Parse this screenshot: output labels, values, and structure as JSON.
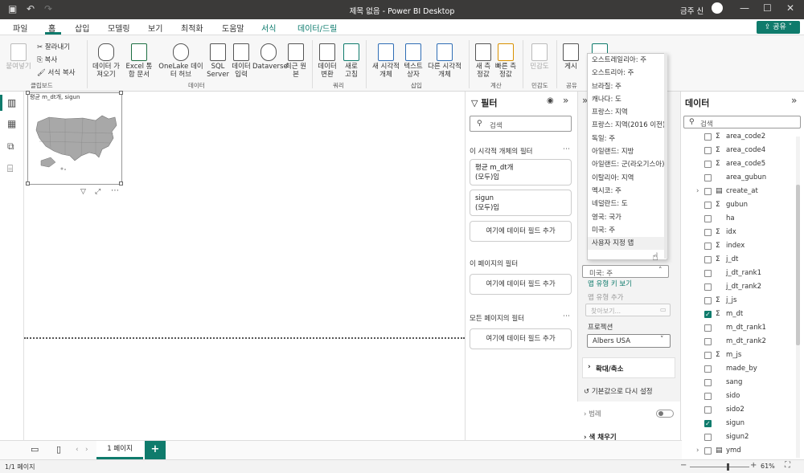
{
  "title": "제목 없음 - Power BI Desktop",
  "user": "금주 신",
  "share_label": "공유",
  "menu": [
    "파일",
    "홈",
    "삽입",
    "모델링",
    "보기",
    "최적화",
    "도움말",
    "서식",
    "데이터/드릴"
  ],
  "ribbon": {
    "clipboard": {
      "paste": "붙여넣기",
      "cut": "잘라내기",
      "copy": "복사",
      "format_painter": "서식 복사",
      "group": "클립보드"
    },
    "data_buttons": [
      "데이터 가져오기",
      "Excel 통합 문서",
      "OneLake 데이터 허브",
      "SQL Server",
      "데이터 입력",
      "Dataverse",
      "최근 원본"
    ],
    "data_group": "데이터",
    "query_buttons": [
      "데이터 변환",
      "새로 고침"
    ],
    "query_group": "쿼리",
    "insert_buttons": [
      "새 시각적 개체",
      "텍스트 상자",
      "다른 시각적 개체"
    ],
    "insert_group": "삽입",
    "calc_buttons": [
      "새 측정값",
      "빠른 측정값"
    ],
    "calc_group": "계산",
    "sensitivity": "민감도",
    "sensitivity_group": "민감도",
    "publish": "게시",
    "share_group": "공유"
  },
  "visual": {
    "title": "평균 m_dt개, sigun"
  },
  "filters": {
    "header": "필터",
    "search_placeholder": "검색",
    "visual_section": "이 시각적 개체의 필터",
    "cards": [
      {
        "name": "평균 m_dt개",
        "state": "(모두)임"
      },
      {
        "name": "sigun",
        "state": "(모두)임"
      }
    ],
    "add_field": "여기에 데이터 필드 추가",
    "page_section": "이 페이지의 필터",
    "all_section": "모든 페이지의 필터"
  },
  "dropdown": {
    "items": [
      "오스트레일리아: 주",
      "오스트리아: 주",
      "브라질: 주",
      "캐나다: 도",
      "프랑스: 지역",
      "프랑스: 지역(2016 이전)",
      "독일: 주",
      "아일랜드: 지방",
      "아일랜드: 군(라오기스아)",
      "이탈리아: 지역",
      "멕시코: 주",
      "네덜란드: 도",
      "영국: 국가",
      "미국: 주",
      "사용자 지정 맵"
    ],
    "highlighted_index": 14
  },
  "format": {
    "selected_map": "미국: 주",
    "view_map_type": "맵 유형 키 보기",
    "add_map_type": "맵 유형 추가",
    "browse": "찾아보기...",
    "projection_label": "프로젝션",
    "projection_value": "Albers USA",
    "zoom": "확대/축소",
    "reset": "기본값으로 다시 설정",
    "legend": "범례",
    "fill": "색 채우기"
  },
  "data_pane": {
    "header": "데이터",
    "search_placeholder": "검색",
    "fields": [
      {
        "name": "area_code2",
        "type": "sigma",
        "checked": false
      },
      {
        "name": "area_code4",
        "type": "sigma",
        "checked": false
      },
      {
        "name": "area_code5",
        "type": "sigma",
        "checked": false
      },
      {
        "name": "area_gubun",
        "type": "text",
        "checked": false
      },
      {
        "name": "create_at",
        "type": "table",
        "checked": false,
        "expandable": true
      },
      {
        "name": "gubun",
        "type": "sigma",
        "checked": false
      },
      {
        "name": "ha",
        "type": "text",
        "checked": false
      },
      {
        "name": "idx",
        "type": "sigma",
        "checked": false
      },
      {
        "name": "index",
        "type": "sigma",
        "checked": false
      },
      {
        "name": "j_dt",
        "type": "sigma",
        "checked": false
      },
      {
        "name": "j_dt_rank1",
        "type": "text",
        "checked": false
      },
      {
        "name": "j_dt_rank2",
        "type": "text",
        "checked": false
      },
      {
        "name": "j_js",
        "type": "sigma",
        "checked": false
      },
      {
        "name": "m_dt",
        "type": "sigma",
        "checked": true
      },
      {
        "name": "m_dt_rank1",
        "type": "text",
        "checked": false
      },
      {
        "name": "m_dt_rank2",
        "type": "text",
        "checked": false
      },
      {
        "name": "m_js",
        "type": "sigma",
        "checked": false
      },
      {
        "name": "made_by",
        "type": "text",
        "checked": false
      },
      {
        "name": "sang",
        "type": "text",
        "checked": false
      },
      {
        "name": "sido",
        "type": "text",
        "checked": false
      },
      {
        "name": "sido2",
        "type": "text",
        "checked": false
      },
      {
        "name": "sigun",
        "type": "text",
        "checked": true
      },
      {
        "name": "sigun2",
        "type": "text",
        "checked": false
      },
      {
        "name": "ymd",
        "type": "table",
        "checked": false,
        "expandable": true
      }
    ]
  },
  "page_tab": "1 페이지",
  "status_left": "1/1 페이지",
  "zoom": "61%",
  "colors": {
    "accent": "#0f7b6c",
    "titlebar": "#3b3a39",
    "ctx_tab": "#0a7a6c"
  }
}
